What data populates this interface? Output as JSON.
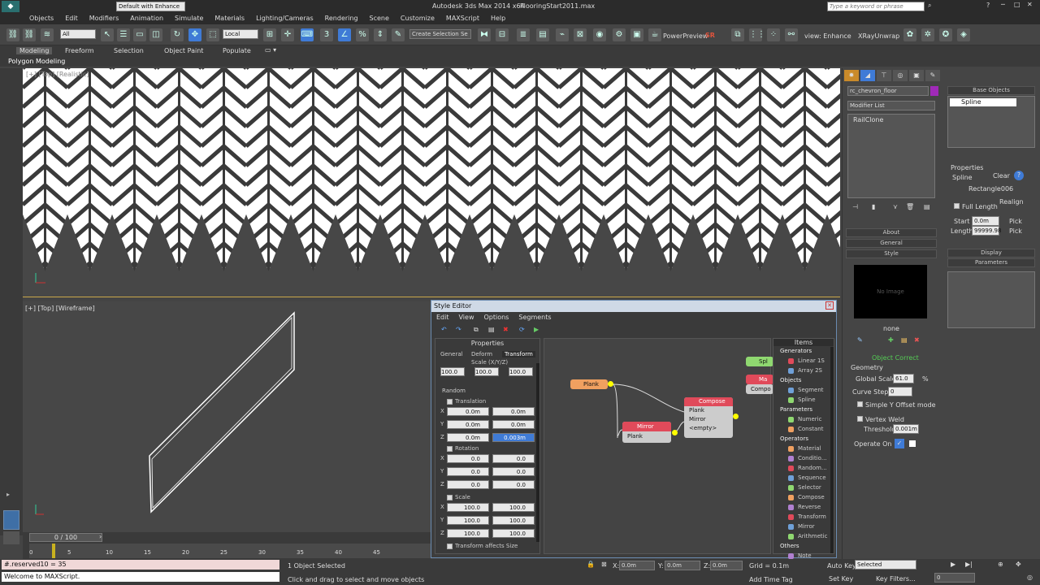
{
  "window": {
    "app_title": "Autodesk 3ds Max 2014 x64",
    "file_name": "FlooringStart2011.max",
    "workspace": "Default with Enhance",
    "search_placeholder": "Type a keyword or phrase"
  },
  "menu": [
    "Objects",
    "Edit",
    "Modifiers",
    "Animation",
    "Simulate",
    "Materials",
    "Lighting/Cameras",
    "Rendering",
    "Scene",
    "Customize",
    "MAXScript",
    "Help"
  ],
  "toolbar": {
    "filter": "All",
    "coord": "Local",
    "selection_set": "Create Selection Se",
    "power_preview": "PowerPreview",
    "sr_label": "SR",
    "view_enhance": "view: Enhance",
    "xray_unwrap": "XRayUnwrap"
  },
  "ribbon": {
    "tabs": [
      "Modeling",
      "Freeform",
      "Selection",
      "Object Paint",
      "Populate"
    ],
    "sub": "Polygon Modeling"
  },
  "viewports": {
    "top_label": "[+] [Top] [Realistic]",
    "bottom_label": "[+] [Top] [Wireframe]"
  },
  "command_panel": {
    "object_name": "rc_chevron_floor",
    "modifier_list": "Modifier List",
    "stack_item": "RailClone",
    "rollouts": [
      "About",
      "General",
      "Style"
    ],
    "no_image": "No Image",
    "none": "none",
    "object_correct": "Object Correct",
    "geometry": "Geometry",
    "global_scale_label": "Global Scale",
    "global_scale": "61.0",
    "global_scale_unit": "%",
    "curve_steps_label": "Curve Steps",
    "curve_steps": "0",
    "simple_y": "Simple Y Offset mode",
    "vertex_weld": "Vertex Weld",
    "threshold_label": "Threshold",
    "threshold": "0.001m",
    "operate_on": "Operate On"
  },
  "right_panel": {
    "base_objects": "Base Objects",
    "spline": "Spline",
    "properties": "Properties",
    "spline_label": "Spline",
    "clear": "Clear",
    "rectangle": "Rectangle006",
    "realign": "Realign",
    "full_length": "Full Length",
    "start_label": "Start",
    "start": "0.0m",
    "length_label": "Length",
    "length": "99999.98",
    "pick": "Pick",
    "display": "Display",
    "parameters": "Parameters"
  },
  "style_editor": {
    "title": "Style Editor",
    "menu": [
      "Edit",
      "View",
      "Options",
      "Segments"
    ],
    "properties_title": "Properties",
    "tabs": [
      "General",
      "Deform",
      "Transform"
    ],
    "scale_header": "Scale (X/Y/Z)",
    "scale_vals": [
      "100.0",
      "100.0",
      "100.0"
    ],
    "random": "Random",
    "translation": "Translation",
    "trans_rows": [
      [
        "X",
        "0.0m",
        "0.0m"
      ],
      [
        "Y",
        "0.0m",
        "0.0m"
      ],
      [
        "Z",
        "0.0m",
        "0.003m"
      ]
    ],
    "rotation": "Rotation",
    "rot_rows": [
      [
        "X",
        "0.0",
        "0.0"
      ],
      [
        "Y",
        "0.0",
        "0.0"
      ],
      [
        "Z",
        "0.0",
        "0.0"
      ]
    ],
    "scale": "Scale",
    "scale_rows": [
      [
        "X",
        "100.0",
        "100.0"
      ],
      [
        "Y",
        "100.0",
        "100.0"
      ],
      [
        "Z",
        "100.0",
        "100.0"
      ]
    ],
    "transform_affects": "Transform affects Size",
    "nodes": {
      "plank": "Plank",
      "compose": "Compose",
      "compose_ins": [
        "Plank",
        "Mirror",
        "<empty>"
      ],
      "mirror": "Mirror",
      "mirror_in": "Plank",
      "spline_node": "Spl",
      "mat_node": "Ma",
      "compo_node": "Compo"
    },
    "items_title": "Items",
    "items": [
      {
        "group": "Generators",
        "entries": [
          "Linear 1S",
          "Array 2S"
        ]
      },
      {
        "group": "Objects",
        "entries": [
          "Segment",
          "Spline"
        ]
      },
      {
        "group": "Parameters",
        "entries": [
          "Numeric",
          "Constant"
        ]
      },
      {
        "group": "Operators",
        "entries": [
          "Material",
          "Conditio...",
          "Random...",
          "Sequence",
          "Selector",
          "Compose",
          "Reverse",
          "Transform",
          "Mirror",
          "Arithmetic"
        ]
      },
      {
        "group": "Others",
        "entries": [
          "Note"
        ]
      }
    ]
  },
  "timeline": {
    "frame": "0 / 100",
    "ticks": [
      "0",
      "5",
      "10",
      "15",
      "20",
      "25",
      "30",
      "35",
      "40",
      "45"
    ]
  },
  "status": {
    "reserved": "#.reserved10 = 35",
    "listener": "Welcome to MAXScript.",
    "selected": "1 Object Selected",
    "prompt": "Click and drag to select and move objects",
    "x_label": "X:",
    "x": "0.0m",
    "y_label": "Y:",
    "y": "0.0m",
    "z_label": "Z:",
    "z": "0.0m",
    "grid": "Grid = 0.1m",
    "add_time_tag": "Add Time Tag",
    "auto_key": "Auto Key",
    "selected_mode": "Selected",
    "set_key": "Set Key",
    "key_filters": "Key Filters...",
    "frame_field": "0"
  }
}
